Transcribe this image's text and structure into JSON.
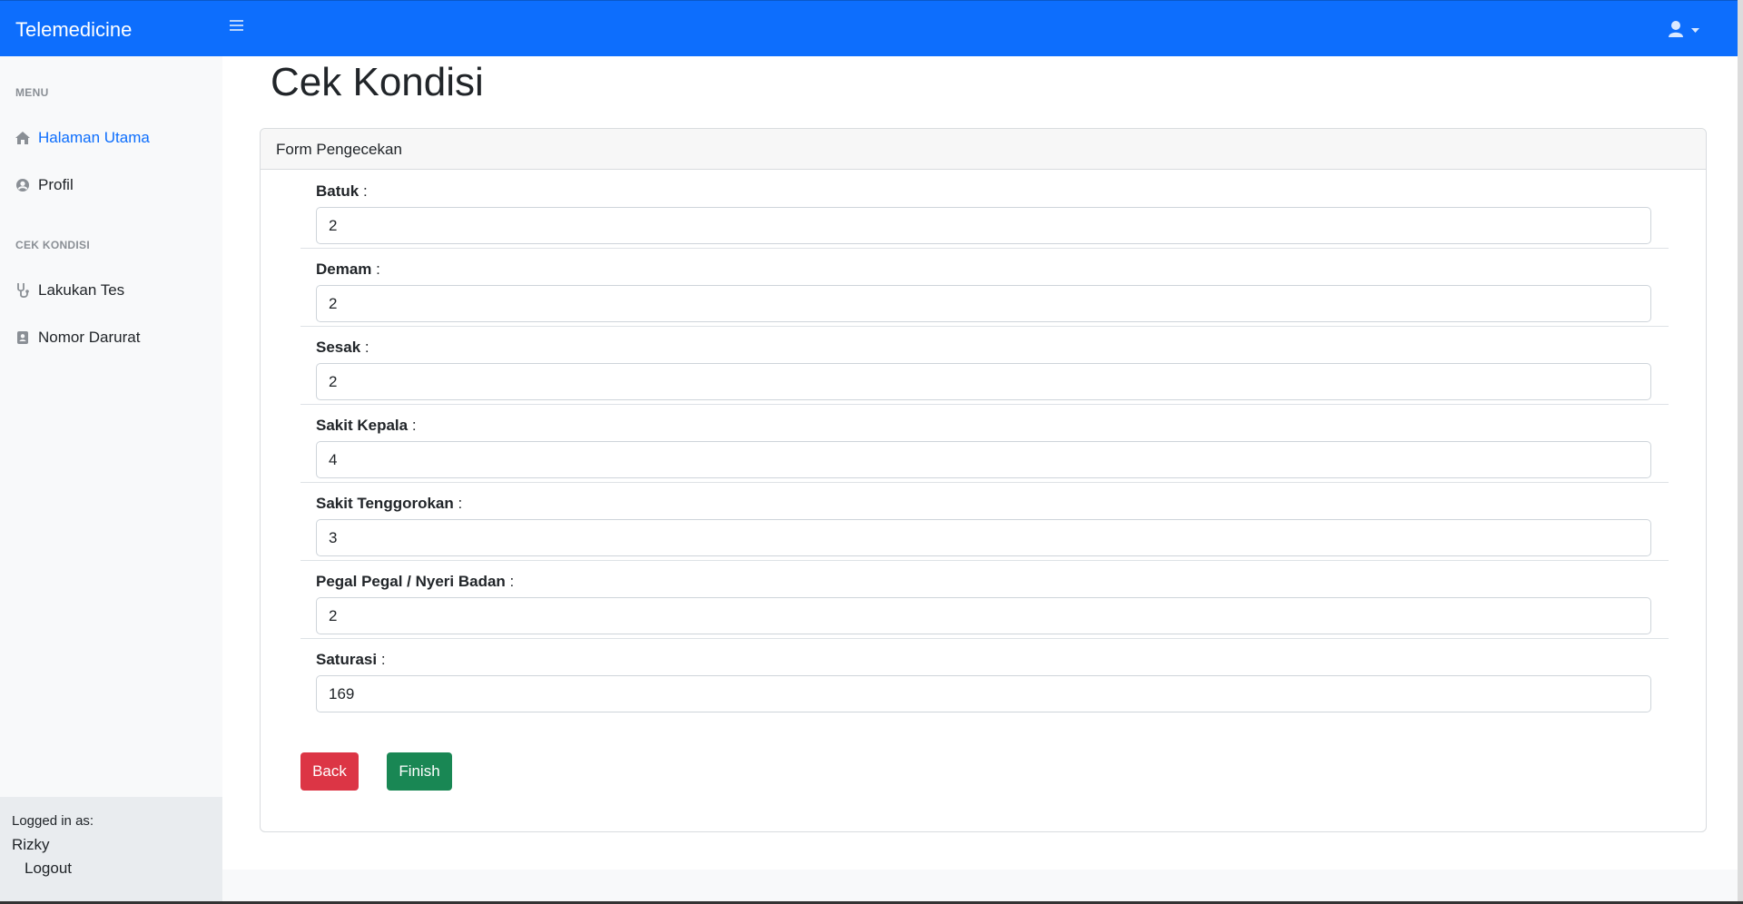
{
  "app": {
    "brand": "Telemedicine"
  },
  "sidebar": {
    "sections": [
      {
        "heading": "MENU",
        "items": [
          {
            "label": "Halaman Utama",
            "icon": "home-icon",
            "active": true
          },
          {
            "label": "Profil",
            "icon": "user-circle-icon",
            "active": false
          }
        ]
      },
      {
        "heading": "CEK KONDISI",
        "items": [
          {
            "label": "Lakukan Tes",
            "icon": "stethoscope-icon",
            "active": false
          },
          {
            "label": "Nomor Darurat",
            "icon": "contact-book-icon",
            "active": false
          }
        ]
      }
    ],
    "footer": {
      "logged_in_label": "Logged in as:",
      "username": "Rizky",
      "logout_label": "Logout"
    }
  },
  "page": {
    "title": "Cek Kondisi",
    "card_title": "Form Pengecekan",
    "fields": [
      {
        "label": "Batuk",
        "value": "2"
      },
      {
        "label": "Demam",
        "value": "2"
      },
      {
        "label": "Sesak",
        "value": "2"
      },
      {
        "label": "Sakit Kepala",
        "value": "4"
      },
      {
        "label": "Sakit Tenggorokan",
        "value": "3"
      },
      {
        "label": "Pegal Pegal / Nyeri Badan",
        "value": "2"
      },
      {
        "label": "Saturasi",
        "value": "169"
      }
    ],
    "label_suffix": " :",
    "buttons": {
      "back": "Back",
      "finish": "Finish"
    }
  },
  "colors": {
    "primary": "#0d6efd",
    "danger": "#dc3545",
    "success": "#198754"
  }
}
